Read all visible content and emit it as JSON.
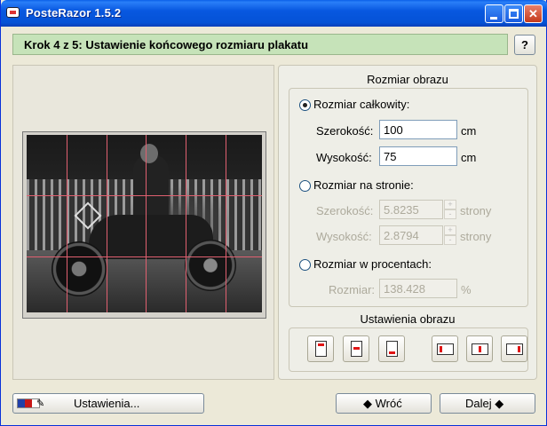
{
  "window": {
    "title": "PosteRazor 1.5.2",
    "controls": {
      "minimize": "minimize-icon",
      "maximize": "maximize-icon",
      "close": "close-icon"
    }
  },
  "header": {
    "step_title": "Krok 4 z 5: Ustawienie końcowego rozmiaru plakatu",
    "help_label": "?"
  },
  "preview": {
    "grid_color": "#E06070",
    "grid_columns": 6,
    "grid_rows": 4
  },
  "size_section": {
    "title": "Rozmiar obrazu",
    "absolute": {
      "label": "Rozmiar całkowity:",
      "selected": true,
      "width_label": "Szerokość:",
      "width_value": "100",
      "width_unit": "cm",
      "height_label": "Wysokość:",
      "height_value": "75",
      "height_unit": "cm"
    },
    "pages": {
      "label": "Rozmiar na stronie:",
      "selected": false,
      "width_label": "Szerokość:",
      "width_value": "5.8235",
      "width_unit": "strony",
      "height_label": "Wysokość:",
      "height_value": "2.8794",
      "height_unit": "strony",
      "spin_up": "+",
      "spin_down": "-"
    },
    "percent": {
      "label": "Rozmiar w procentach:",
      "selected": false,
      "size_label": "Rozmiar:",
      "size_value": "138.428",
      "size_unit": "%"
    }
  },
  "image_section": {
    "title": "Ustawienia obrazu",
    "alignment_buttons": [
      "align-top",
      "align-center",
      "align-bottom",
      "align-left",
      "align-middle",
      "align-right"
    ]
  },
  "footer": {
    "settings_label": "Ustawienia...",
    "back_label": "◆ Wróć",
    "next_label": "Dalej ◆",
    "back_arrow": "◆",
    "next_arrow": "◆"
  },
  "colors": {
    "title_bar": "#0A5FE8",
    "header_bg": "#C6E3B9",
    "marker": "#E01515"
  }
}
